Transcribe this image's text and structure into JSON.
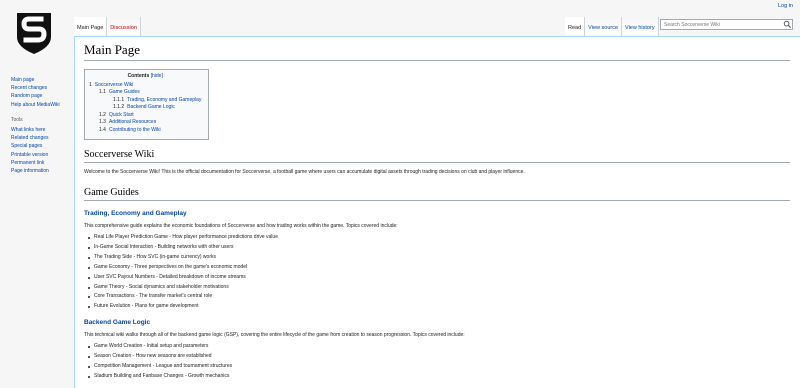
{
  "personal": {
    "login": "Log in"
  },
  "tabs": {
    "left": [
      "Main Page",
      "Discussion"
    ],
    "right": [
      "Read",
      "View source",
      "View history"
    ]
  },
  "search": {
    "placeholder": "Search Soccerverse Wiki"
  },
  "sidebar": {
    "nav": [
      "Main page",
      "Recent changes",
      "Random page",
      "Help about MediaWiki"
    ],
    "tools_heading": "Tools",
    "tools": [
      "What links here",
      "Related changes",
      "Special pages",
      "Printable version",
      "Permanent link",
      "Page information"
    ]
  },
  "page": {
    "title": "Main Page"
  },
  "toc": {
    "title": "Contents",
    "toggle": "[hide]",
    "items": [
      {
        "num": "1",
        "label": "Soccerverse Wiki"
      },
      {
        "num": "1.1",
        "label": "Game Guides"
      },
      {
        "num": "1.1.1",
        "label": "Trading, Economy and Gameplay"
      },
      {
        "num": "1.1.2",
        "label": "Backend Game Logic"
      },
      {
        "num": "1.2",
        "label": "Quick Start"
      },
      {
        "num": "1.3",
        "label": "Additional Resources"
      },
      {
        "num": "1.4",
        "label": "Contributing to the Wiki"
      }
    ]
  },
  "content": {
    "h_wiki": "Soccerverse Wiki",
    "intro": "Welcome to the Soccerverse Wiki! This is the official documentation for Soccerverse, a football game where users can accumulate digital assets through trading decisions on club and player influence.",
    "h_guides": "Game Guides",
    "trading": {
      "heading": "Trading, Economy and Gameplay",
      "desc": "This comprehensive guide explains the economic foundations of Soccerverse and how trading works within the game. Topics covered include:",
      "items": [
        "Real Life Player Prediction Game - How player performance predictions drive value",
        "In-Game Social Interaction - Building networks with other users",
        "The Trading Side - How SVC (in-game currency) works",
        "Game Economy - Three perspectives on the game's economic model",
        "User SVC Payout Numbers - Detailed breakdown of income streams",
        "Game Theory - Social dynamics and stakeholder motivations",
        "Core Transactions - The transfer market's central role",
        "Future Evolution - Plans for game development"
      ]
    },
    "backend": {
      "heading": "Backend Game Logic",
      "desc": "This technical wiki walks through all of the backend game logic (GSP), covering the entire lifecycle of the game from creation to season progression. Topics covered include:",
      "items": [
        "Game World Creation - Initial setup and parameters",
        "Season Creation - How new seasons are established",
        "Competition Management - League and tournament structures",
        "Stadium Building and Fanbase Changes - Growth mechanics"
      ]
    }
  }
}
